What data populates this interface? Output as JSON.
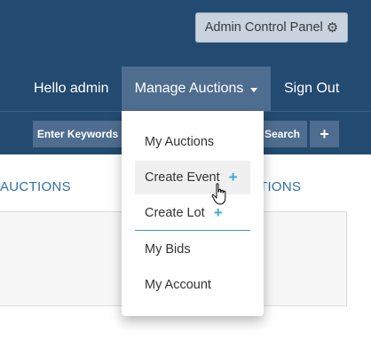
{
  "header": {
    "admin_button_label": "Admin Control Panel",
    "admin_button_icon": "gear-icon",
    "greeting": "Hello admin",
    "manage_label": "Manage Auctions",
    "signout_label": "Sign Out",
    "colors": {
      "bar": "#234a70",
      "active": "#4f6e8f",
      "accent": "#3fa9d6"
    }
  },
  "search": {
    "keywords_label": "Enter Keywords",
    "search_label": "Search",
    "add_label": "+"
  },
  "tabs": {
    "left": "AUCTIONS",
    "right": "TIONS"
  },
  "dropdown": {
    "items": [
      {
        "label": "My Auctions"
      },
      {
        "label": "Create Event",
        "icon": "+"
      },
      {
        "label": "Create Lot",
        "icon": "+"
      },
      {
        "label": "My Bids"
      },
      {
        "label": "My Account"
      }
    ]
  }
}
